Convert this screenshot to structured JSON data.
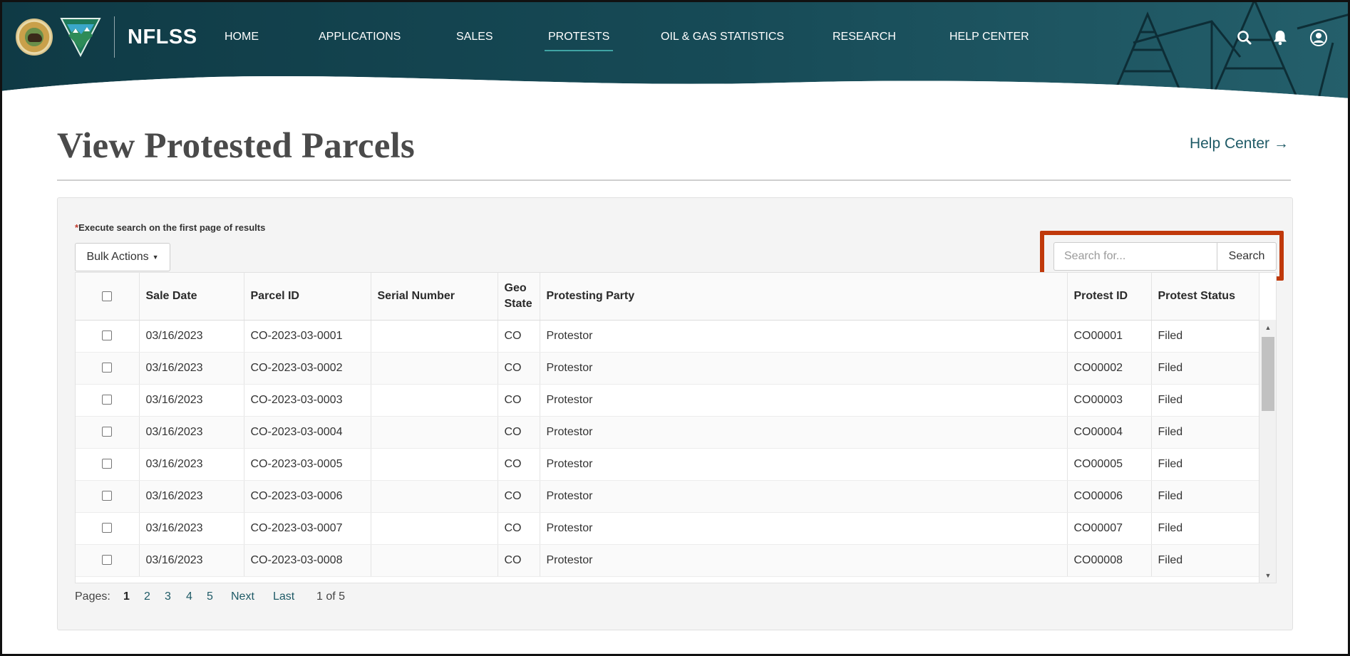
{
  "brand": {
    "name": "NFLSS"
  },
  "nav": {
    "items": [
      {
        "label": "HOME"
      },
      {
        "label": "APPLICATIONS"
      },
      {
        "label": "SALES"
      },
      {
        "label": "PROTESTS",
        "active": true
      },
      {
        "label": "OIL & GAS STATISTICS"
      },
      {
        "label": "RESEARCH"
      },
      {
        "label": "HELP CENTER"
      }
    ]
  },
  "header_icons": [
    "search-icon",
    "bell-icon",
    "user-icon"
  ],
  "page": {
    "title": "View Protested Parcels",
    "help_link": "Help Center",
    "notice_star": "*",
    "notice": "Execute search on the first page of results"
  },
  "toolbar": {
    "bulk_actions": "Bulk Actions",
    "search_placeholder": "Search for...",
    "search_button": "Search"
  },
  "table": {
    "columns": [
      "Sale Date",
      "Parcel ID",
      "Serial Number",
      "Geo State",
      "Protesting Party",
      "Protest ID",
      "Protest Status"
    ],
    "rows": [
      [
        "03/16/2023",
        "CO-2023-03-0001",
        "",
        "CO",
        "Protestor",
        "CO00001",
        "Filed"
      ],
      [
        "03/16/2023",
        "CO-2023-03-0002",
        "",
        "CO",
        "Protestor",
        "CO00002",
        "Filed"
      ],
      [
        "03/16/2023",
        "CO-2023-03-0003",
        "",
        "CO",
        "Protestor",
        "CO00003",
        "Filed"
      ],
      [
        "03/16/2023",
        "CO-2023-03-0004",
        "",
        "CO",
        "Protestor",
        "CO00004",
        "Filed"
      ],
      [
        "03/16/2023",
        "CO-2023-03-0005",
        "",
        "CO",
        "Protestor",
        "CO00005",
        "Filed"
      ],
      [
        "03/16/2023",
        "CO-2023-03-0006",
        "",
        "CO",
        "Protestor",
        "CO00006",
        "Filed"
      ],
      [
        "03/16/2023",
        "CO-2023-03-0007",
        "",
        "CO",
        "Protestor",
        "CO00007",
        "Filed"
      ],
      [
        "03/16/2023",
        "CO-2023-03-0008",
        "",
        "CO",
        "Protestor",
        "CO00008",
        "Filed"
      ]
    ]
  },
  "pagination": {
    "label": "Pages:",
    "pages": [
      "1",
      "2",
      "3",
      "4",
      "5"
    ],
    "current": "1",
    "next": "Next",
    "last": "Last",
    "summary": "1 of 5"
  },
  "colors": {
    "header_dark": "#0f3a45",
    "header_teal": "#1b5a63",
    "link": "#1e5a66",
    "highlight": "#c0390b",
    "active_underline": "#3fa4a4"
  }
}
